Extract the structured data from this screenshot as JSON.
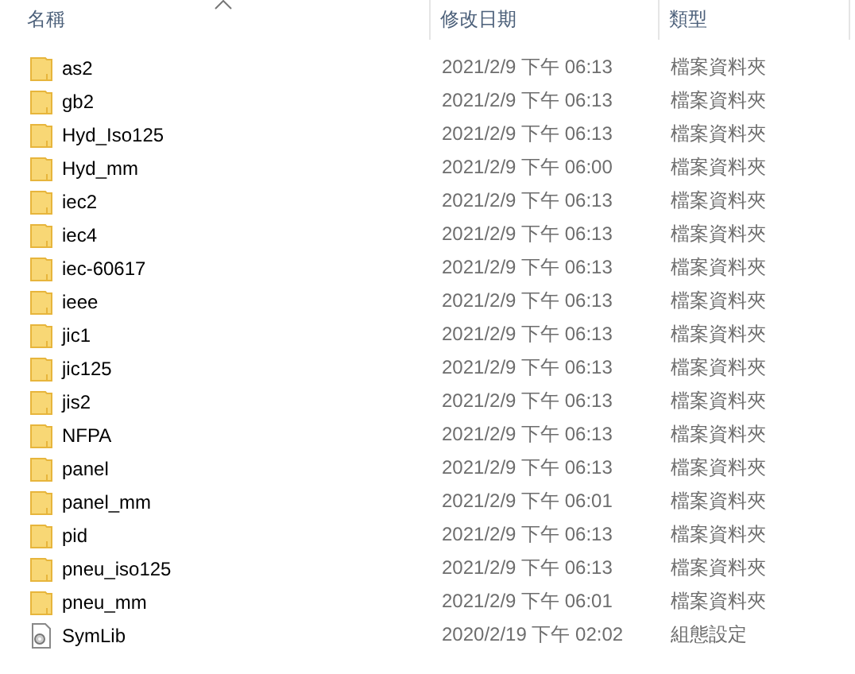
{
  "columns": [
    {
      "label": "名稱"
    },
    {
      "label": "修改日期"
    },
    {
      "label": "類型"
    }
  ],
  "rows": [
    {
      "kind": "folder",
      "name": "as2",
      "modified": "2021/2/9 下午 06:13",
      "type": "檔案資料夾"
    },
    {
      "kind": "folder",
      "name": "gb2",
      "modified": "2021/2/9 下午 06:13",
      "type": "檔案資料夾"
    },
    {
      "kind": "folder",
      "name": "Hyd_Iso125",
      "modified": "2021/2/9 下午 06:13",
      "type": "檔案資料夾"
    },
    {
      "kind": "folder",
      "name": "Hyd_mm",
      "modified": "2021/2/9 下午 06:00",
      "type": "檔案資料夾"
    },
    {
      "kind": "folder",
      "name": "iec2",
      "modified": "2021/2/9 下午 06:13",
      "type": "檔案資料夾"
    },
    {
      "kind": "folder",
      "name": "iec4",
      "modified": "2021/2/9 下午 06:13",
      "type": "檔案資料夾"
    },
    {
      "kind": "folder",
      "name": "iec-60617",
      "modified": "2021/2/9 下午 06:13",
      "type": "檔案資料夾"
    },
    {
      "kind": "folder",
      "name": "ieee",
      "modified": "2021/2/9 下午 06:13",
      "type": "檔案資料夾"
    },
    {
      "kind": "folder",
      "name": "jic1",
      "modified": "2021/2/9 下午 06:13",
      "type": "檔案資料夾"
    },
    {
      "kind": "folder",
      "name": "jic125",
      "modified": "2021/2/9 下午 06:13",
      "type": "檔案資料夾"
    },
    {
      "kind": "folder",
      "name": "jis2",
      "modified": "2021/2/9 下午 06:13",
      "type": "檔案資料夾"
    },
    {
      "kind": "folder",
      "name": "NFPA",
      "modified": "2021/2/9 下午 06:13",
      "type": "檔案資料夾"
    },
    {
      "kind": "folder",
      "name": "panel",
      "modified": "2021/2/9 下午 06:13",
      "type": "檔案資料夾"
    },
    {
      "kind": "folder",
      "name": "panel_mm",
      "modified": "2021/2/9 下午 06:01",
      "type": "檔案資料夾"
    },
    {
      "kind": "folder",
      "name": "pid",
      "modified": "2021/2/9 下午 06:13",
      "type": "檔案資料夾"
    },
    {
      "kind": "folder",
      "name": "pneu_iso125",
      "modified": "2021/2/9 下午 06:13",
      "type": "檔案資料夾"
    },
    {
      "kind": "folder",
      "name": "pneu_mm",
      "modified": "2021/2/9 下午 06:01",
      "type": "檔案資料夾"
    },
    {
      "kind": "config",
      "name": "SymLib",
      "modified": "2020/2/19 下午 02:02",
      "type": "組態設定"
    }
  ]
}
